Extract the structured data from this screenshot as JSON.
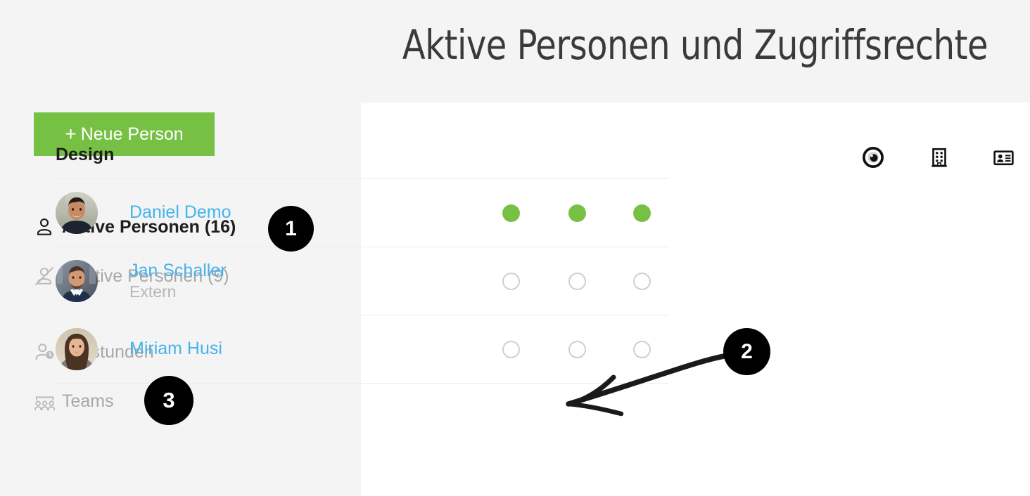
{
  "page": {
    "title": "Aktive Personen und Zugriffsrechte",
    "background_color": "#f4f4f4",
    "panel_color": "#ffffff"
  },
  "colors": {
    "accent_green": "#76c043",
    "link_blue": "#45b3ed",
    "muted_gray": "#a8a8a8",
    "text_dark": "#1d1d1d",
    "badge_black": "#000000"
  },
  "sidebar": {
    "new_person_button": {
      "label": "Neue Person",
      "plus": "+",
      "icon": "plus-icon",
      "background": "#76c043"
    },
    "items": [
      {
        "id": "aktive-personen",
        "label": "Aktive Personen (16)",
        "icon": "person-icon",
        "state": "active"
      },
      {
        "id": "inaktive-personen",
        "label": "Inaktive Personen (9)",
        "icon": "person-disabled-icon",
        "state": "muted"
      },
      {
        "id": "sollstunden",
        "label": "Sollstunden",
        "icon": "person-clock-icon",
        "state": "muted"
      },
      {
        "id": "teams",
        "label": "Teams",
        "icon": "team-group-icon",
        "state": "muted"
      }
    ]
  },
  "callouts": [
    {
      "id": "callout-1",
      "number": "1",
      "target": "aktive-personen"
    },
    {
      "id": "callout-2",
      "number": "2",
      "target": "person-subtitle-extern"
    },
    {
      "id": "callout-3",
      "number": "3",
      "target": "teams"
    }
  ],
  "annotations": {
    "arrow": {
      "name": "hand-drawn-arrow",
      "direction": "left",
      "points_to": "Extern"
    }
  },
  "table": {
    "group_header": "Design",
    "column_icons": [
      {
        "id": "visibility",
        "icon": "eye-iris-icon"
      },
      {
        "id": "company",
        "icon": "building-icon"
      },
      {
        "id": "identity",
        "icon": "id-card-icon"
      }
    ],
    "rows": [
      {
        "name": "Daniel Demo",
        "subtitle": "",
        "avatar": "avatar-daniel",
        "permissions": [
          "on",
          "on",
          "on"
        ]
      },
      {
        "name": "Jan Schaller",
        "subtitle": "Extern",
        "avatar": "avatar-jan",
        "permissions": [
          "off",
          "off",
          "off"
        ]
      },
      {
        "name": "Miriam Husi",
        "subtitle": "",
        "avatar": "avatar-miriam",
        "permissions": [
          "off",
          "off",
          "off"
        ]
      }
    ]
  }
}
